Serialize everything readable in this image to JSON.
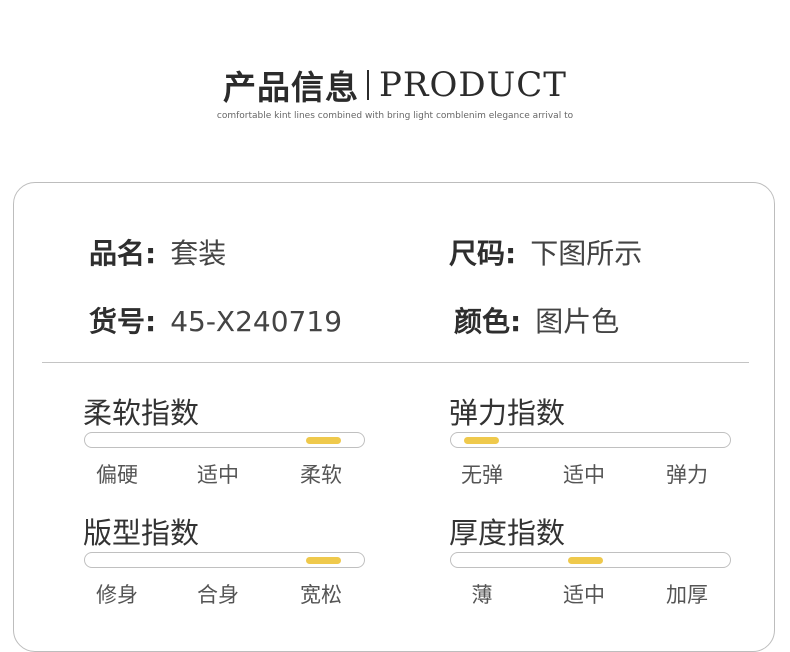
{
  "header": {
    "title_cn": "产品信息",
    "title_en": "PRODUCT",
    "subtitle": "comfortable kint lines combined with bring light comblenim elegance arrival to"
  },
  "info": {
    "name_label": "品名:",
    "name_value": "套装",
    "size_label": "尺码:",
    "size_value": "下图所示",
    "sku_label": "货号:",
    "sku_value": "45-X240719",
    "color_label": "颜色:",
    "color_value": "图片色"
  },
  "indices": [
    {
      "title": "柔软指数",
      "labels": [
        "偏硬",
        "适中",
        "柔软"
      ],
      "level": 0.85
    },
    {
      "title": "弹力指数",
      "labels": [
        "无弹",
        "适中",
        "弹力"
      ],
      "level": 0.11
    },
    {
      "title": "版型指数",
      "labels": [
        "修身",
        "合身",
        "宽松"
      ],
      "level": 0.85
    },
    {
      "title": "厚度指数",
      "labels": [
        "薄",
        "适中",
        "加厚"
      ],
      "level": 0.48
    }
  ],
  "colors": {
    "accent": "#efc94c",
    "border": "#bdbdbd",
    "text": "#333333"
  }
}
